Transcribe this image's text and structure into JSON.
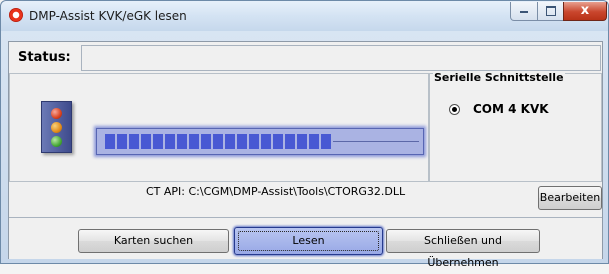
{
  "window": {
    "title": "DMP-Assist KVK/eGK lesen",
    "close_glyph": "x"
  },
  "status": {
    "label": "Status:",
    "value": ""
  },
  "reader": {
    "progress_fraction": 0.73,
    "accent_color": "#4859d3"
  },
  "serial": {
    "group_title": "Serielle Schnittstelle",
    "option_label": "COM 4 KVK",
    "selected": true
  },
  "api": {
    "text": "CT API: C:\\CGM\\DMP-Assist\\Tools\\CTORG32.DLL",
    "edit_button": "Bearbeiten"
  },
  "buttons": {
    "search": "Karten suchen",
    "read": "Lesen",
    "close_apply": "Schließen und Übernehmen"
  }
}
